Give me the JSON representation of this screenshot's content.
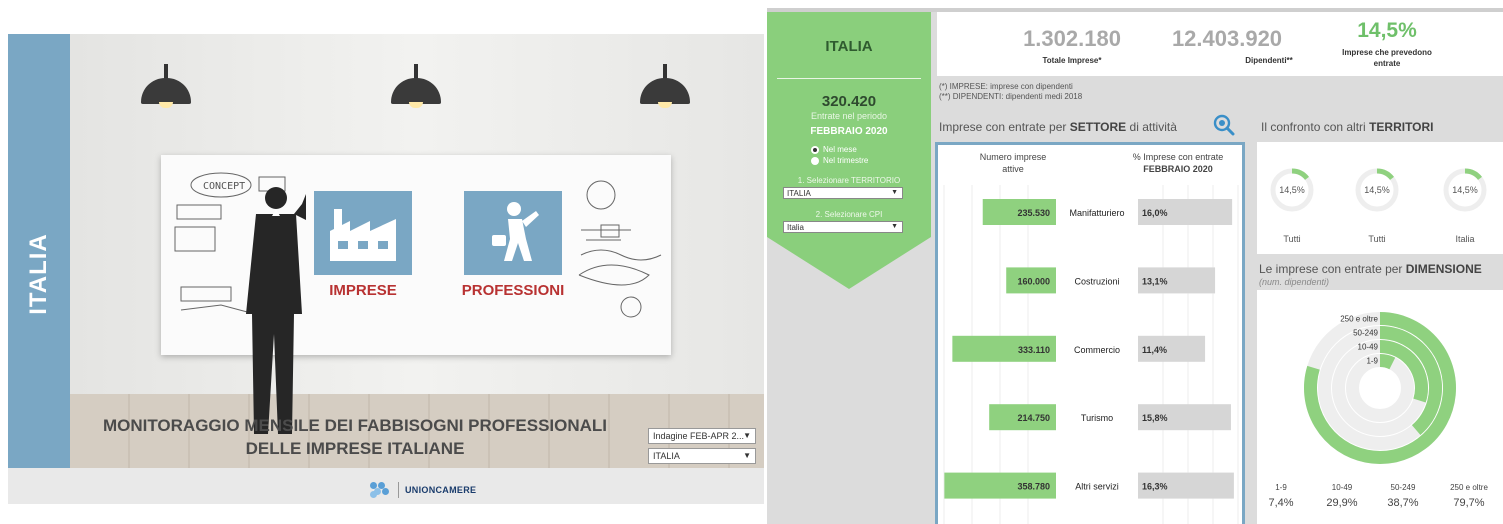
{
  "left": {
    "sidebar_label": "ITALIA",
    "tiles": [
      {
        "label": "IMPRESE",
        "icon": "factory-icon"
      },
      {
        "label": "PROFESSIONI",
        "icon": "walking-professional-icon"
      }
    ],
    "title_line1": "MONITORAGGIO MENSILE DEI FABBISOGNI PROFESSIONALI",
    "title_line2": "DELLE IMPRESE ITALIANE",
    "select_survey": "Indagine FEB-APR 2...",
    "select_territory": "ITALIA",
    "logo_text": "UNIONCAMERE"
  },
  "side_panel": {
    "title": "ITALIA",
    "entrate_value": "320.420",
    "entrate_label": "Entrate nel periodo",
    "month": "FEBBRAIO 2020",
    "radio_month": "Nel mese",
    "radio_quarter": "Nel trimestre",
    "label_territory": "1. Selezionare TERRITORIO",
    "select_territory": "ITALIA",
    "label_cpi": "2. Selezionare CPI",
    "select_cpi": "Italia"
  },
  "kpis": {
    "totale_value": "1.302.180",
    "totale_label": "Totale Imprese*",
    "dipendenti_value": "12.403.920",
    "dipendenti_label": "Dipendenti**",
    "pct_value": "14,5%",
    "pct_label_1": "Imprese che prevedono",
    "pct_label_2": "entrate"
  },
  "notes": {
    "note1": "(*)  IMPRESE: imprese con dipendenti",
    "note2": "(**) DIPENDENTI: dipendenti medi 2018"
  },
  "sections": {
    "sector_title_pre": "Imprese con entrate per ",
    "sector_title_bold": "SETTORE",
    "sector_title_post": " di attività",
    "territory_title_pre": "Il confronto con altri ",
    "territory_title_bold": "TERRITORI",
    "dimension_title_pre": "Le imprese con entrate per ",
    "dimension_title_bold": "DIMENSIONE",
    "dimension_subtitle": "(num. dipendenti)"
  },
  "sector_headers": {
    "left_1": "Numero imprese",
    "left_2": "attive",
    "right_1": "% Imprese con entrate",
    "right_2": "FEBBRAIO 2020"
  },
  "territory_gauges": [
    {
      "value": "14,5%",
      "fraction": 0.145,
      "label": "Tutti"
    },
    {
      "value": "14,5%",
      "fraction": 0.145,
      "label": "Tutti"
    },
    {
      "value": "14,5%",
      "fraction": 0.145,
      "label": "Italia"
    }
  ],
  "colors": {
    "accent_blue": "#7aa7c4",
    "green": "#8acf7c",
    "bar_green": "#8fd17f",
    "bar_gray": "#d6d6d6",
    "tile_red": "#b83232"
  },
  "chart_data": [
    {
      "type": "bar",
      "categories": [
        "Manifatturiero",
        "Costruzioni",
        "Commercio",
        "Turismo",
        "Altri servizi"
      ],
      "series": [
        {
          "name": "Numero imprese attive",
          "values": [
            235530,
            160000,
            333110,
            214750,
            358780
          ],
          "labels": [
            "235.530",
            "160.000",
            "333.110",
            "214.750",
            "358.780"
          ]
        },
        {
          "name": "% Imprese con entrate FEBBRAIO 2020",
          "values": [
            16.0,
            13.1,
            11.4,
            15.8,
            16.3
          ],
          "labels": [
            "16,0%",
            "13,1%",
            "11,4%",
            "15,8%",
            "16,3%"
          ]
        }
      ]
    },
    {
      "type": "pie",
      "categories": [
        "1-9",
        "10-49",
        "50-249",
        "250 e oltre"
      ],
      "values": [
        7.4,
        29.9,
        38.7,
        79.7
      ],
      "labels": [
        "7,4%",
        "29,9%",
        "38,7%",
        "79,7%"
      ],
      "ring_labels": [
        "250 e oltre",
        "50-249",
        "10-49",
        "1-9"
      ]
    }
  ]
}
